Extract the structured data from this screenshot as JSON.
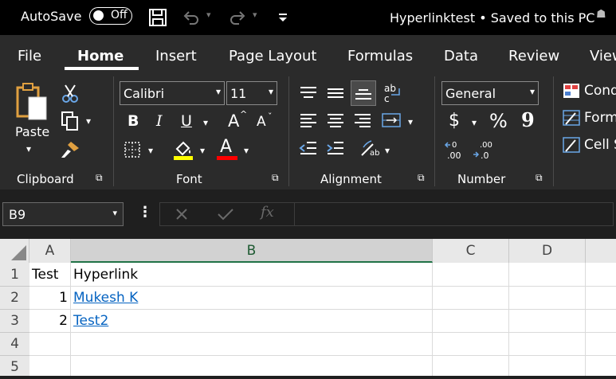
{
  "titlebar": {
    "autosave_label": "AutoSave",
    "toggle_state": "Off",
    "file_title": "Hyperlinktest • Saved to this PC"
  },
  "tabs": [
    "File",
    "Home",
    "Insert",
    "Page Layout",
    "Formulas",
    "Data",
    "Review",
    "View"
  ],
  "ribbon": {
    "clipboard": {
      "paste_label": "Paste",
      "group_label": "Clipboard"
    },
    "font": {
      "font_name": "Calibri",
      "font_size": "11",
      "bold": "B",
      "italic": "I",
      "underline": "U",
      "grow": "A",
      "shrink": "A",
      "fill_letter": "",
      "font_color_letter": "A",
      "group_label": "Font"
    },
    "alignment": {
      "group_label": "Alignment",
      "wrap_text_glyph": "ab"
    },
    "number": {
      "format": "General",
      "currency": "$",
      "percent": "%",
      "comma": "9",
      "inc_decimal": ".00",
      "dec_decimal": ".00",
      "group_label": "Number"
    },
    "styles": {
      "conditional": "Cond",
      "format_table": "Form",
      "cell_styles": "Cell S"
    }
  },
  "formula_bar": {
    "name_box": "B9",
    "fx": "fx"
  },
  "sheet": {
    "columns": [
      "A",
      "B",
      "C",
      "D"
    ],
    "rows": [
      "1",
      "2",
      "3",
      "4",
      "5"
    ],
    "cells": {
      "A1": "Test",
      "B1": "Hyperlink",
      "A2": "1",
      "B2": "Mukesh K",
      "A3": "2",
      "B3": "Test2"
    }
  },
  "colors": {
    "accent": "#217346",
    "link": "#0563c1",
    "fill_yellow": "#ffff00",
    "font_red": "#ff0000"
  }
}
